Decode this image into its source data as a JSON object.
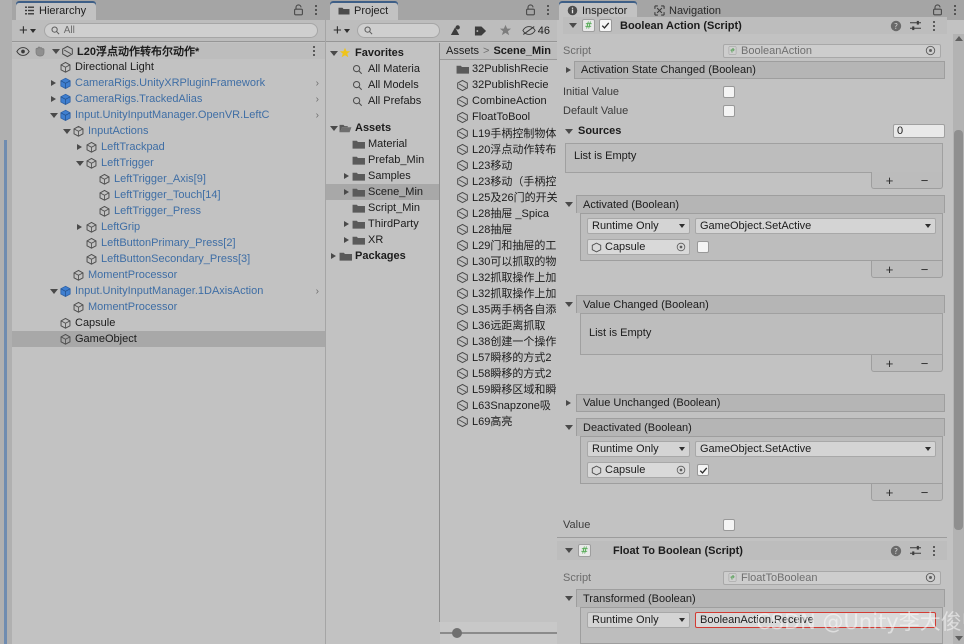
{
  "hierarchy": {
    "tab_label": "Hierarchy",
    "toolbar": {
      "create_label": "+",
      "search_placeholder": "All"
    },
    "scene_name": "L20浮点动作转布尔动作*",
    "items": [
      {
        "label": "Directional Light",
        "depth": 2,
        "icon": "gameobject-icon",
        "arrow": "none",
        "prefab": false,
        "selected": false,
        "overflow": false
      },
      {
        "label": "CameraRigs.UnityXRPluginFramework",
        "depth": 2,
        "icon": "prefab-icon",
        "arrow": "right",
        "prefab": true,
        "selected": false,
        "overflow": true
      },
      {
        "label": "CameraRigs.TrackedAlias",
        "depth": 2,
        "icon": "prefab-icon",
        "arrow": "right",
        "prefab": true,
        "selected": false,
        "overflow": true
      },
      {
        "label": "Input.UnityInputManager.OpenVR.LeftC",
        "depth": 2,
        "icon": "prefab-icon",
        "arrow": "down",
        "prefab": true,
        "selected": false,
        "overflow": true
      },
      {
        "label": "InputActions",
        "depth": 3,
        "icon": "gameobject-icon",
        "arrow": "down",
        "prefab": true,
        "selected": false,
        "overflow": false
      },
      {
        "label": "LeftTrackpad",
        "depth": 4,
        "icon": "gameobject-icon",
        "arrow": "right",
        "prefab": true,
        "selected": false,
        "overflow": false
      },
      {
        "label": "LeftTrigger",
        "depth": 4,
        "icon": "gameobject-icon",
        "arrow": "down",
        "prefab": true,
        "selected": false,
        "overflow": false
      },
      {
        "label": "LeftTrigger_Axis[9]",
        "depth": 5,
        "icon": "gameobject-icon",
        "arrow": "none",
        "prefab": true,
        "selected": false,
        "overflow": false
      },
      {
        "label": "LeftTrigger_Touch[14]",
        "depth": 5,
        "icon": "gameobject-icon",
        "arrow": "none",
        "prefab": true,
        "selected": false,
        "overflow": false
      },
      {
        "label": "LeftTrigger_Press",
        "depth": 5,
        "icon": "gameobject-icon",
        "arrow": "none",
        "prefab": true,
        "selected": false,
        "overflow": false
      },
      {
        "label": "LeftGrip",
        "depth": 4,
        "icon": "gameobject-icon",
        "arrow": "right",
        "prefab": true,
        "selected": false,
        "overflow": false
      },
      {
        "label": "LeftButtonPrimary_Press[2]",
        "depth": 4,
        "icon": "gameobject-icon",
        "arrow": "none",
        "prefab": true,
        "selected": false,
        "overflow": false
      },
      {
        "label": "LeftButtonSecondary_Press[3]",
        "depth": 4,
        "icon": "gameobject-icon",
        "arrow": "none",
        "prefab": true,
        "selected": false,
        "overflow": false
      },
      {
        "label": "MomentProcessor",
        "depth": 3,
        "icon": "gameobject-icon",
        "arrow": "none",
        "prefab": true,
        "selected": false,
        "overflow": false
      },
      {
        "label": "Input.UnityInputManager.1DAxisAction",
        "depth": 2,
        "icon": "prefab-icon",
        "arrow": "down",
        "prefab": true,
        "selected": false,
        "overflow": true
      },
      {
        "label": "MomentProcessor",
        "depth": 3,
        "icon": "gameobject-icon",
        "arrow": "none",
        "prefab": true,
        "selected": false,
        "overflow": false
      },
      {
        "label": "Capsule",
        "depth": 2,
        "icon": "gameobject-icon",
        "arrow": "none",
        "prefab": false,
        "selected": false,
        "overflow": false
      },
      {
        "label": "GameObject",
        "depth": 2,
        "icon": "gameobject-icon",
        "arrow": "none",
        "prefab": false,
        "selected": true,
        "overflow": false
      }
    ]
  },
  "project": {
    "tab_label": "Project",
    "toolbar": {
      "create_label": "+",
      "search_placeholder": "",
      "count_badge": "46"
    },
    "breadcrumb": {
      "root": "Assets",
      "separator": ">",
      "current": "Scene_Min"
    },
    "tree": [
      {
        "label": "Favorites",
        "depth": 0,
        "icon": "star-icon",
        "arrow": "down",
        "bold": true,
        "selected": false
      },
      {
        "label": "All Materia",
        "depth": 1,
        "icon": "search-icon",
        "arrow": "none",
        "bold": false,
        "selected": false
      },
      {
        "label": "All Models",
        "depth": 1,
        "icon": "search-icon",
        "arrow": "none",
        "bold": false,
        "selected": false
      },
      {
        "label": "All Prefabs",
        "depth": 1,
        "icon": "search-icon",
        "arrow": "none",
        "bold": false,
        "selected": false
      },
      {
        "label": "",
        "depth": 0,
        "icon": "none",
        "arrow": "none",
        "bold": false,
        "selected": false
      },
      {
        "label": "Assets",
        "depth": 0,
        "icon": "folder-open-icon",
        "arrow": "down",
        "bold": true,
        "selected": false
      },
      {
        "label": "Material",
        "depth": 1,
        "icon": "folder-icon",
        "arrow": "none",
        "bold": false,
        "selected": false
      },
      {
        "label": "Prefab_Min",
        "depth": 1,
        "icon": "folder-icon",
        "arrow": "none",
        "bold": false,
        "selected": false
      },
      {
        "label": "Samples",
        "depth": 1,
        "icon": "folder-icon",
        "arrow": "right",
        "bold": false,
        "selected": false
      },
      {
        "label": "Scene_Min",
        "depth": 1,
        "icon": "folder-icon",
        "arrow": "right",
        "bold": false,
        "selected": true
      },
      {
        "label": "Script_Min",
        "depth": 1,
        "icon": "folder-icon",
        "arrow": "none",
        "bold": false,
        "selected": false
      },
      {
        "label": "ThirdParty",
        "depth": 1,
        "icon": "folder-icon",
        "arrow": "right",
        "bold": false,
        "selected": false
      },
      {
        "label": "XR",
        "depth": 1,
        "icon": "folder-icon",
        "arrow": "right",
        "bold": false,
        "selected": false
      },
      {
        "label": "Packages",
        "depth": 0,
        "icon": "folder-icon",
        "arrow": "right",
        "bold": true,
        "selected": false
      }
    ],
    "files": [
      {
        "label": "32PublishRecie",
        "icon": "folder-icon"
      },
      {
        "label": "32PublishRecie",
        "icon": "scene-icon"
      },
      {
        "label": "CombineAction",
        "icon": "scene-icon"
      },
      {
        "label": "FloatToBool",
        "icon": "scene-icon"
      },
      {
        "label": "L19手柄控制物体",
        "icon": "scene-icon"
      },
      {
        "label": "L20浮点动作转布",
        "icon": "scene-icon"
      },
      {
        "label": "L23移动",
        "icon": "scene-icon"
      },
      {
        "label": "L23移动（手柄控",
        "icon": "scene-icon"
      },
      {
        "label": "L25及26门的开关",
        "icon": "scene-icon"
      },
      {
        "label": "L28抽屉 _Spica",
        "icon": "scene-icon"
      },
      {
        "label": "L28抽屉",
        "icon": "scene-icon"
      },
      {
        "label": "L29门和抽屉的工",
        "icon": "scene-icon"
      },
      {
        "label": "L30可以抓取的物",
        "icon": "scene-icon"
      },
      {
        "label": "L32抓取操作上加",
        "icon": "scene-icon"
      },
      {
        "label": "L32抓取操作上加",
        "icon": "scene-icon"
      },
      {
        "label": "L35两手柄各自添",
        "icon": "scene-icon"
      },
      {
        "label": "L36远距离抓取",
        "icon": "scene-icon"
      },
      {
        "label": "L38创建一个操作",
        "icon": "scene-icon"
      },
      {
        "label": "L57瞬移的方式2",
        "icon": "scene-icon"
      },
      {
        "label": "L58瞬移的方式2",
        "icon": "scene-icon"
      },
      {
        "label": "L59瞬移区域和瞬",
        "icon": "scene-icon"
      },
      {
        "label": "L63Snapzone吸",
        "icon": "scene-icon"
      },
      {
        "label": "L69高亮",
        "icon": "scene-icon"
      }
    ]
  },
  "inspector": {
    "tabs": [
      {
        "label": "Inspector",
        "icon": "info-icon",
        "active": true
      },
      {
        "label": "Navigation",
        "icon": "navigation-icon",
        "active": false
      }
    ],
    "boolean_action": {
      "component_title": "Boolean Action (Script)",
      "script_label": "Script",
      "script_value": "BooleanAction",
      "enabled": true,
      "activation_state_changed": {
        "label": "Activation State Changed (Boolean)",
        "expanded": false
      },
      "initial_value": {
        "label": "Initial Value",
        "checked": false
      },
      "default_value": {
        "label": "Default Value",
        "checked": false
      },
      "sources": {
        "label": "Sources",
        "count": "0",
        "empty_text": "List is Empty",
        "add": "+",
        "remove": "−"
      },
      "activated": {
        "label": "Activated (Boolean)",
        "expanded": true,
        "mode": "Runtime Only",
        "method": "GameObject.SetActive",
        "target": "Capsule",
        "arg_checked": false,
        "add": "+",
        "remove": "−"
      },
      "value_changed": {
        "label": "Value Changed (Boolean)",
        "expanded": true,
        "empty_text": "List is Empty",
        "add": "+",
        "remove": "−"
      },
      "value_unchanged": {
        "label": "Value Unchanged (Boolean)",
        "expanded": false
      },
      "deactivated": {
        "label": "Deactivated (Boolean)",
        "expanded": true,
        "mode": "Runtime Only",
        "method": "GameObject.SetActive",
        "target": "Capsule",
        "arg_checked": true,
        "add": "+",
        "remove": "−"
      },
      "value": {
        "label": "Value",
        "checked": false
      }
    },
    "float_to_boolean": {
      "component_title": "Float To Boolean (Script)",
      "script_label": "Script",
      "script_value": "FloatToBoolean",
      "enabled": true,
      "transformed": {
        "label": "Transformed (Boolean)",
        "expanded": true,
        "mode": "Runtime Only",
        "method": "BooleanAction.Receive",
        "highlighted": true
      }
    }
  },
  "watermark": "CSDN @Unity李大俊师",
  "colors": {
    "panel_bg": "#c2c2c2",
    "chrome_bg": "#a5a5a5",
    "header_bg": "#bdbdbd",
    "selection": "#a8a8a8",
    "prefab_blue": "#3f6ea5",
    "tab_accent": "#3e5f87",
    "highlight_red": "#d23b33",
    "favorites_star": "#f0c419"
  }
}
